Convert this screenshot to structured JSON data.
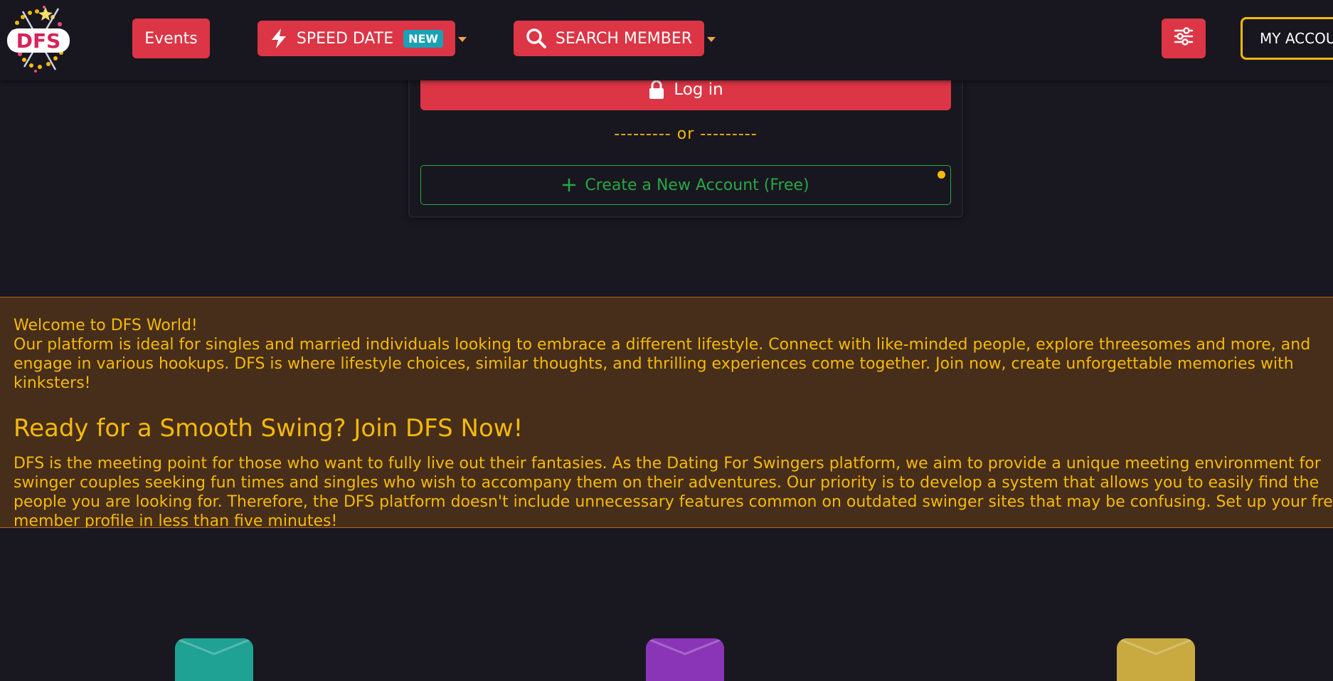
{
  "navbar": {
    "logo_text": "DFS",
    "events_label": "Events",
    "speed_date_label": "SPEED DATE",
    "speed_date_badge": "NEW",
    "search_member_label": "SEARCH MEMBER",
    "account_label": "MY ACCOUNT",
    "icons": {
      "speed_date": "lightning-icon",
      "search": "search-icon",
      "filter": "sliders-icon",
      "dropdown": "caret-down-icon"
    }
  },
  "login": {
    "login_label": "Log in",
    "separator": "--------- or ---------",
    "create_account_label": "Create a New Account (Free)",
    "icons": {
      "login": "lock-icon",
      "create": "plus-icon"
    }
  },
  "welcome": {
    "title": "Welcome to DFS World!",
    "intro": "Our platform is ideal for singles and married individuals looking to embrace a different lifestyle. Connect with like-minded people, explore threesomes and more, and engage in various hookups. DFS is where lifestyle choices, similar thoughts, and thrilling experiences come together. Join now, create unforgettable memories with kinksters!",
    "heading": "Ready for a Smooth Swing? Join DFS Now!",
    "body": "DFS is the meeting point for those who want to fully live out their fantasies. As the Dating For Swingers platform, we aim to provide a unique meeting environment for swinger couples seeking fun times and singles who wish to accompany them on their adventures. Our priority is to develop a system that allows you to easily find the people you are looking for. Therefore, the DFS platform doesn't include unnecessary features common on outdated swinger sites that may be confusing. Set up your free member profile in less than five minutes!"
  },
  "colors": {
    "background": "#191821",
    "primary_red": "#dc3545",
    "accent_gold": "#f5b90a",
    "success_green": "#28a745",
    "banner_bg": "#472e1a",
    "badge_teal": "#1ba1b5",
    "feature_teal": "#1fa194",
    "feature_purple": "#8a35b8",
    "feature_gold": "#c8aa40"
  }
}
